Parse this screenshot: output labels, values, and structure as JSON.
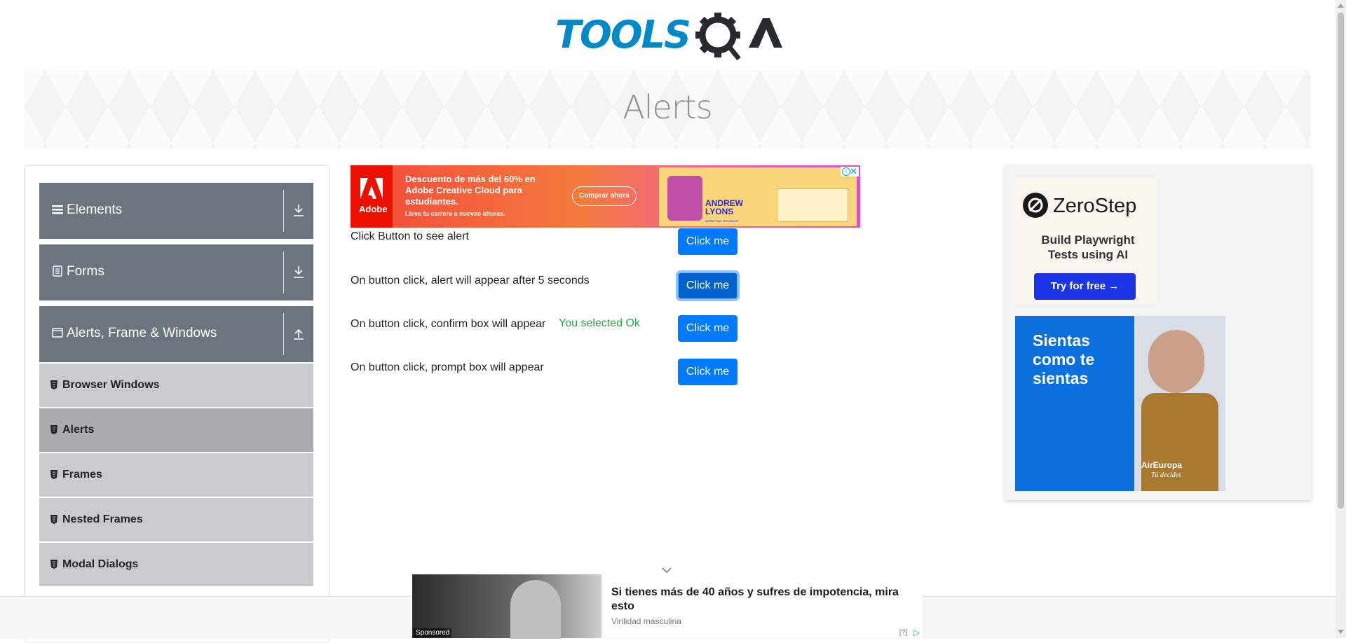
{
  "header": {
    "logo_text": "TOOLSQA",
    "logo_color_blue": "#0088c7",
    "logo_color_dark": "#272b30"
  },
  "banner": {
    "title": "Alerts"
  },
  "sidebar": {
    "groups": [
      {
        "label": "Elements",
        "icon": "hamburger-icon",
        "arrow": "download-arrow-icon"
      },
      {
        "label": "Forms",
        "icon": "form-icon",
        "arrow": "download-arrow-icon"
      },
      {
        "label": "Alerts, Frame & Windows",
        "icon": "window-icon",
        "arrow": "upload-arrow-icon"
      }
    ],
    "items": [
      {
        "label": "Browser Windows",
        "active": false
      },
      {
        "label": "Alerts",
        "active": true
      },
      {
        "label": "Frames",
        "active": false
      },
      {
        "label": "Nested Frames",
        "active": false
      },
      {
        "label": "Modal Dialogs",
        "active": false
      }
    ]
  },
  "ad_top": {
    "brand": "Adobe",
    "headline": "Descuento de más del 60% en Adobe Creative Cloud para estudiantes.",
    "sub": "Lleva tu carrera a nuevas alturas.",
    "cta": "Comprar ahora",
    "name": "ANDREW LYONS",
    "role": "MARKETING SPECIALIST"
  },
  "alerts": {
    "rows": [
      {
        "text": "Click Button to see alert",
        "button": "Click me"
      },
      {
        "text": "On button click, alert will appear after 5 seconds",
        "button": "Click me"
      },
      {
        "text": "On button click, confirm box will appear",
        "button": "Click me"
      },
      {
        "text": "On button click, prompt box will appear",
        "button": "Click me"
      }
    ],
    "confirm_result": "You selected Ok"
  },
  "ad_right": {
    "brand": "ZeroStep",
    "tagline": "Build Playwright Tests using AI",
    "cta": "Try for free →",
    "promo": "Sientas como te sientas",
    "airline": "AirEuropa",
    "airline_slogan": "Tú decides"
  },
  "ad_bottom": {
    "sponsored": "Sponsored",
    "headline": "Si tienes más de 40 años y sufres de impotencia, mira esto",
    "source": "Virilidad masculina",
    "info": "[?]"
  },
  "colors": {
    "primary": "#007bff",
    "success": "#28a745",
    "group_bg": "#6c757d",
    "item_bg": "#cacbcc"
  }
}
